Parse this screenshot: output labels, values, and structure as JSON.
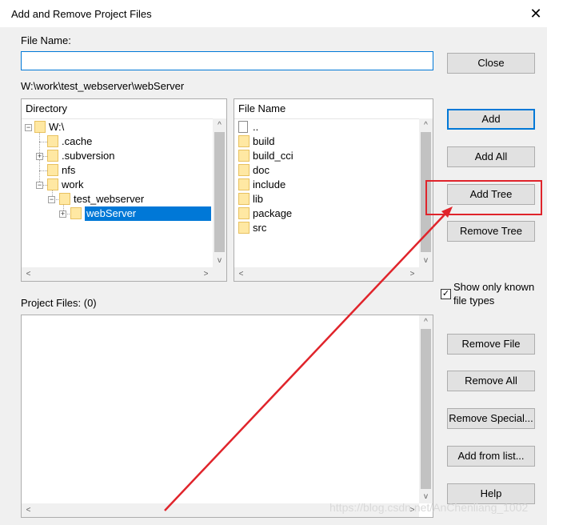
{
  "window": {
    "title": "Add and Remove Project Files",
    "close_glyph": "✕"
  },
  "file_name": {
    "label": "File Name:",
    "value": ""
  },
  "current_path": "W:\\work\\test_webserver\\webServer",
  "directory": {
    "header": "Directory",
    "nodes": [
      {
        "label": "W:\\",
        "expander": "−"
      },
      {
        "label": ".cache",
        "expander": ""
      },
      {
        "label": ".subversion",
        "expander": "+"
      },
      {
        "label": "nfs",
        "expander": ""
      },
      {
        "label": "work",
        "expander": "−"
      },
      {
        "label": "test_webserver",
        "expander": "−"
      },
      {
        "label": "webServer",
        "expander": "+",
        "selected": true
      }
    ]
  },
  "files": {
    "header": "File Name",
    "items": [
      {
        "label": "..",
        "kind": "file-icon"
      },
      {
        "label": "build",
        "kind": "folder-icon"
      },
      {
        "label": "build_cci",
        "kind": "folder-icon"
      },
      {
        "label": "doc",
        "kind": "folder-icon"
      },
      {
        "label": "include",
        "kind": "folder-icon"
      },
      {
        "label": "lib",
        "kind": "folder-icon"
      },
      {
        "label": "package",
        "kind": "folder-icon"
      },
      {
        "label": "src",
        "kind": "folder-icon"
      }
    ]
  },
  "buttons": {
    "close": "Close",
    "add": "Add",
    "add_all": "Add All",
    "add_tree": "Add Tree",
    "remove_tree": "Remove Tree",
    "remove_file": "Remove File",
    "remove_all": "Remove All",
    "remove_special": "Remove Special...",
    "add_from_list": "Add from list...",
    "help": "Help"
  },
  "show_known": {
    "label_line1": "Show only known",
    "label_line2": "file types",
    "checked": true,
    "check_glyph": "✓"
  },
  "project_files": {
    "label": "Project Files: (0)"
  },
  "scroll_glyphs": {
    "up": "▲",
    "down": "▼",
    "left": "◀",
    "right": "▶",
    "up_chevron": "^",
    "down_chevron": "v",
    "left_chevron": "<",
    "right_chevron": ">"
  },
  "watermark": "https://blog.csdn.net/AnChenliang_1002",
  "annotation": {
    "color": "#e0242b"
  },
  "colors": {
    "selection": "#0078d7",
    "focus_border": "#0078d7"
  }
}
